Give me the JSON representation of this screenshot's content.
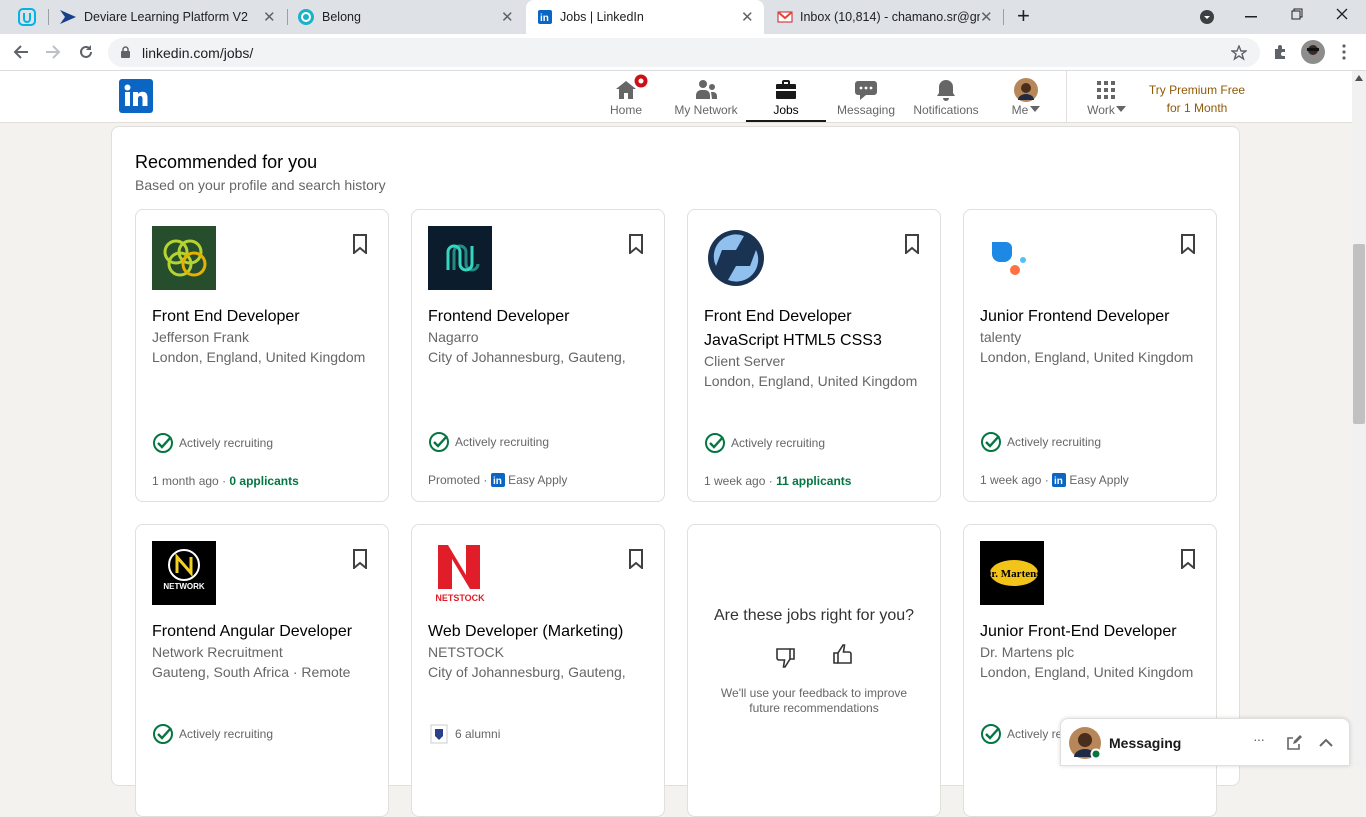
{
  "browser": {
    "tabs": [
      {
        "title": "",
        "icon": "udacity-icon"
      },
      {
        "title": "Deviare Learning Platform V2",
        "icon": "deviare-icon"
      },
      {
        "title": "Belong",
        "icon": "belong-icon"
      },
      {
        "title": "Jobs | LinkedIn",
        "icon": "linkedin-icon"
      },
      {
        "title": "Inbox (10,814) - chamano.sr@gm",
        "icon": "gmail-icon"
      }
    ],
    "close_glyph": "✕",
    "new_tab_glyph": "+",
    "url": "linkedin.com/jobs/"
  },
  "nav": {
    "items": [
      {
        "label": "Home",
        "badge": true
      },
      {
        "label": "My Network"
      },
      {
        "label": "Jobs",
        "active": true
      },
      {
        "label": "Messaging"
      },
      {
        "label": "Notifications"
      },
      {
        "label": "Me"
      },
      {
        "label": "Work"
      }
    ],
    "premium_line1": "Try Premium Free",
    "premium_line2": "for 1 Month"
  },
  "recommended": {
    "title": "Recommended for you",
    "subtitle": "Based on your profile and search history",
    "jobs": [
      {
        "title": "Front End Developer",
        "company": "Jefferson Frank",
        "location": "London, England, United Kingdom",
        "recruiting": "Actively recruiting",
        "time": "1 month ago",
        "extra": "0 applicants",
        "logo": "jefferson-frank-logo"
      },
      {
        "title": "Frontend Developer",
        "company": "Nagarro",
        "location": "City of Johannesburg, Gauteng,",
        "recruiting": "Actively recruiting",
        "time": "Promoted",
        "extra": "Easy Apply",
        "logo": "nagarro-logo"
      },
      {
        "title": "Front End Developer JavaScript HTML5 CSS3",
        "company": "Client Server",
        "location": "London, England, United Kingdom",
        "recruiting": "Actively recruiting",
        "time": "1 week ago",
        "extra": "11 applicants",
        "logo": "client-server-logo"
      },
      {
        "title": "Junior Frontend Developer",
        "company": "talenty",
        "location": "London, England, United Kingdom",
        "recruiting": "Actively recruiting",
        "time": "1 week ago",
        "extra": "Easy Apply",
        "logo": "talenty-logo"
      },
      {
        "title": "Frontend Angular Developer",
        "company": "Network Recruitment",
        "location": "Gauteng, South Africa · Remote",
        "recruiting": "Actively recruiting",
        "logo": "network-recruitment-logo",
        "logo_text": "NETWORK"
      },
      {
        "title": "Web Developer (Marketing)",
        "company": "NETSTOCK",
        "location": "City of Johannesburg, Gauteng,",
        "alumni": "6 alumni",
        "logo": "netstock-logo",
        "logo_text": "NETSTOCK"
      },
      {
        "title": "Junior Front-End Developer",
        "company": "Dr. Martens plc",
        "location": "London, England, United Kingdom",
        "recruiting": "Actively re",
        "logo": "dr-martens-logo",
        "logo_text": "Dr. Martens"
      }
    ],
    "feedback": {
      "question": "Are these jobs right for you?",
      "note_line1": "We'll use your feedback to improve",
      "note_line2": "future recommendations"
    },
    "dot": "·"
  },
  "messaging": {
    "label": "Messaging",
    "more": "···"
  }
}
